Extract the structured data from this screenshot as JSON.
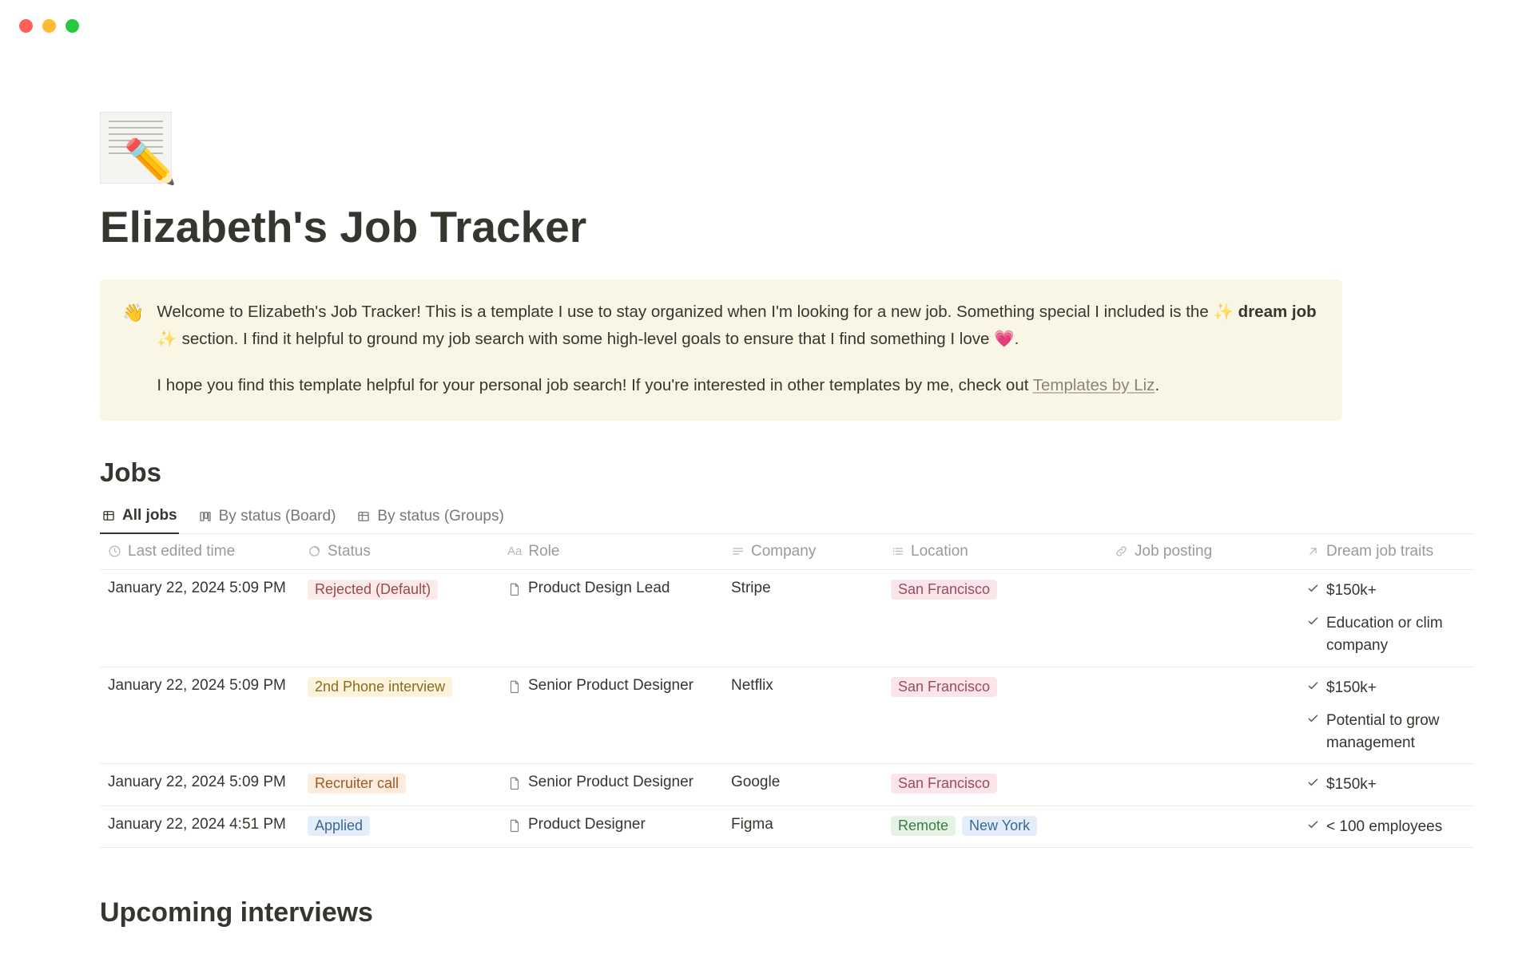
{
  "page": {
    "title": "Elizabeth's Job Tracker"
  },
  "callout": {
    "icon": "👋",
    "text_before_bold": "Welcome to Elizabeth's Job Tracker! This is a template I use to stay organized when I'm looking for a new job. Something special I included is the ",
    "sparkle": "✨",
    "bold": "dream job",
    "text_mid": " section. I find it helpful to ground my job search with some high-level goals to ensure that I find something I love ",
    "heart": "💗",
    "text_after_heart": ".",
    "para2_before_link": "I hope you find this template helpful for your personal job search! If you're interested in other templates by me, check out ",
    "link_text": "Templates by Liz",
    "para2_after_link": "."
  },
  "sections": {
    "jobs": "Jobs",
    "upcoming": "Upcoming interviews"
  },
  "tabs": [
    {
      "label": "All jobs",
      "icon": "table",
      "active": true
    },
    {
      "label": "By status (Board)",
      "icon": "board",
      "active": false
    },
    {
      "label": "By status (Groups)",
      "icon": "table",
      "active": false
    }
  ],
  "columns": {
    "time": {
      "label": "Last edited time",
      "icon": "clock"
    },
    "status": {
      "label": "Status",
      "icon": "status"
    },
    "role": {
      "label": "Role",
      "icon": "aa"
    },
    "company": {
      "label": "Company",
      "icon": "lines"
    },
    "location": {
      "label": "Location",
      "icon": "list"
    },
    "posting": {
      "label": "Job posting",
      "icon": "link"
    },
    "traits": {
      "label": "Dream job traits",
      "icon": "arrow"
    }
  },
  "rows": [
    {
      "time": "January 22, 2024 5:09 PM",
      "status": {
        "text": "Rejected (Default)",
        "color": "red"
      },
      "role": "Product Design Lead",
      "company": "Stripe",
      "locations": [
        {
          "text": "San Francisco",
          "color": "pink"
        }
      ],
      "traits": [
        "$150k+",
        "Education or clim company"
      ]
    },
    {
      "time": "January 22, 2024 5:09 PM",
      "status": {
        "text": "2nd Phone interview",
        "color": "yellow"
      },
      "role": "Senior Product Designer",
      "company": "Netflix",
      "locations": [
        {
          "text": "San Francisco",
          "color": "pink"
        }
      ],
      "traits": [
        "$150k+",
        "Potential to grow management"
      ]
    },
    {
      "time": "January 22, 2024 5:09 PM",
      "status": {
        "text": "Recruiter call",
        "color": "orange"
      },
      "role": "Senior Product Designer",
      "company": "Google",
      "locations": [
        {
          "text": "San Francisco",
          "color": "pink"
        }
      ],
      "traits": [
        "$150k+"
      ]
    },
    {
      "time": "January 22, 2024 4:51 PM",
      "status": {
        "text": "Applied",
        "color": "blue"
      },
      "role": "Product Designer",
      "company": "Figma",
      "locations": [
        {
          "text": "Remote",
          "color": "green"
        },
        {
          "text": "New York",
          "color": "blue"
        }
      ],
      "traits": [
        "< 100 employees"
      ]
    }
  ]
}
